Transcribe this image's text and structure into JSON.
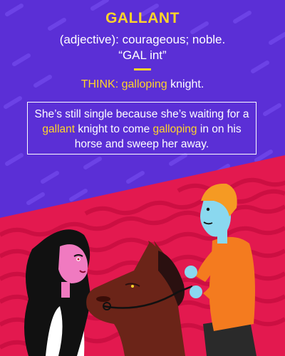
{
  "entry": {
    "word": "GALLANT",
    "definition": "(adjective): courageous; noble.",
    "pronunciation": "“GAL int”"
  },
  "think": {
    "label": "THINK:",
    "cue": "galloping",
    "rest": " knight."
  },
  "sentence": {
    "part1": "She’s still single because she’s waiting for a ",
    "word": "gallant",
    "part2": " knight to come ",
    "cue": "galloping",
    "part3": " in on his horse and sweep her away."
  },
  "colors": {
    "background_purple": "#5b2fd6",
    "accent_yellow": "#ffd42a",
    "ground_red": "#e3194f",
    "text_white": "#ffffff"
  }
}
